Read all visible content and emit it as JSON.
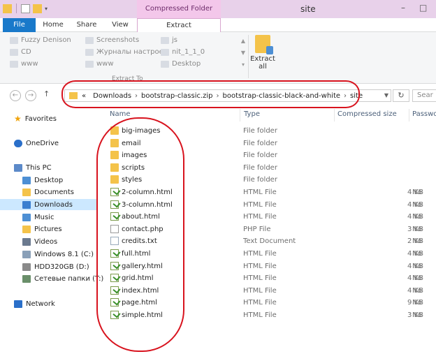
{
  "window": {
    "title": "site",
    "context_group": "Compressed Folder Tools"
  },
  "tabs": {
    "file": "File",
    "home": "Home",
    "share": "Share",
    "view": "View",
    "extract": "Extract"
  },
  "ribbon": {
    "destinations": [
      "Fuzzy Denison",
      "Screenshots",
      "js",
      "CD",
      "Журналы настроек",
      "nit_1_1_0",
      "www",
      "www",
      "Desktop"
    ],
    "group_label": "Extract To",
    "extract_all": [
      "Extract",
      "all"
    ]
  },
  "address": {
    "overflow": "«",
    "crumbs": [
      "Downloads",
      "bootstrap-classic.zip",
      "bootstrap-classic-black-and-white",
      "site"
    ],
    "search_placeholder": "Sear"
  },
  "navpane": {
    "favorites": "Favorites",
    "onedrive": "OneDrive",
    "thispc": "This PC",
    "items": [
      "Desktop",
      "Documents",
      "Downloads",
      "Music",
      "Pictures",
      "Videos",
      "Windows 8.1 (C:)",
      "HDD320GB (D:)",
      "Сетевые папки (T:)"
    ],
    "network": "Network"
  },
  "columns": {
    "name": "Name",
    "type": "Type",
    "size": "Compressed size",
    "password": "Passwo"
  },
  "files": [
    {
      "name": "big-images",
      "type": "File folder",
      "size": "",
      "password": "",
      "icon": "folder-icon"
    },
    {
      "name": "email",
      "type": "File folder",
      "size": "",
      "password": "",
      "icon": "folder-icon"
    },
    {
      "name": "images",
      "type": "File folder",
      "size": "",
      "password": "",
      "icon": "folder-icon"
    },
    {
      "name": "scripts",
      "type": "File folder",
      "size": "",
      "password": "",
      "icon": "folder-icon"
    },
    {
      "name": "styles",
      "type": "File folder",
      "size": "",
      "password": "",
      "icon": "folder-icon"
    },
    {
      "name": "2-column.html",
      "type": "HTML File",
      "size": "4 KB",
      "password": "No",
      "icon": "html-file-icon"
    },
    {
      "name": "3-column.html",
      "type": "HTML File",
      "size": "4 KB",
      "password": "No",
      "icon": "html-file-icon"
    },
    {
      "name": "about.html",
      "type": "HTML File",
      "size": "4 KB",
      "password": "No",
      "icon": "html-file-icon"
    },
    {
      "name": "contact.php",
      "type": "PHP File",
      "size": "3 KB",
      "password": "No",
      "icon": "php-file-icon"
    },
    {
      "name": "credits.txt",
      "type": "Text Document",
      "size": "2 KB",
      "password": "No",
      "icon": "text-file-icon"
    },
    {
      "name": "full.html",
      "type": "HTML File",
      "size": "4 KB",
      "password": "No",
      "icon": "html-file-icon"
    },
    {
      "name": "gallery.html",
      "type": "HTML File",
      "size": "4 KB",
      "password": "No",
      "icon": "html-file-icon"
    },
    {
      "name": "grid.html",
      "type": "HTML File",
      "size": "4 KB",
      "password": "No",
      "icon": "html-file-icon"
    },
    {
      "name": "index.html",
      "type": "HTML File",
      "size": "4 KB",
      "password": "No",
      "icon": "html-file-icon"
    },
    {
      "name": "page.html",
      "type": "HTML File",
      "size": "9 KB",
      "password": "No",
      "icon": "html-file-icon"
    },
    {
      "name": "simple.html",
      "type": "HTML File",
      "size": "3 KB",
      "password": "No",
      "icon": "html-file-icon"
    }
  ],
  "colors": {
    "file_tab": "#1979ca",
    "context_tab": "#f3c7ea",
    "annotation": "#d8131e",
    "selected": "#cce8ff"
  }
}
